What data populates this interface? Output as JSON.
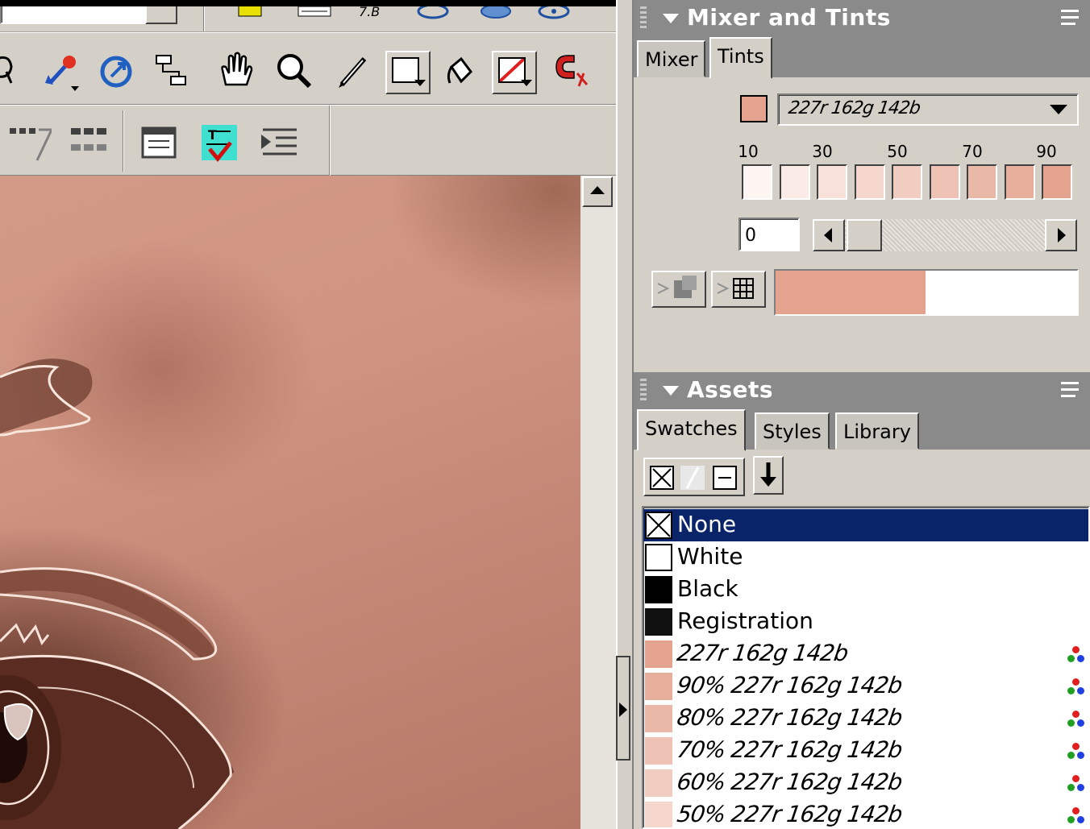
{
  "mixer_panel": {
    "title": "Mixer and Tints",
    "tabs": [
      {
        "label": "Mixer",
        "active": false
      },
      {
        "label": "Tints",
        "active": true
      }
    ],
    "base_color": "#e4a38e",
    "base_color_name": "227r 162g 142b",
    "tint_scale_labels": [
      "10",
      "30",
      "50",
      "70",
      "90"
    ],
    "tint_swatches": [
      "#fdf5f2",
      "#faebe7",
      "#f7e1d9",
      "#f4d6cd",
      "#f1ccc0",
      "#eec2b4",
      "#eab8a7",
      "#e7ae9b",
      "#e4a38e"
    ],
    "tint_value": "0",
    "preview_new": "#e4a38e",
    "preview_old": "#ffffff"
  },
  "assets_panel": {
    "title": "Assets",
    "tabs": [
      {
        "label": "Swatches",
        "active": true
      },
      {
        "label": "Styles",
        "active": false
      },
      {
        "label": "Library",
        "active": false
      }
    ],
    "swatches": [
      {
        "label": "None",
        "color": "none",
        "selected": true,
        "kind": "system"
      },
      {
        "label": "White",
        "color": "#ffffff",
        "selected": false,
        "kind": "system"
      },
      {
        "label": "Black",
        "color": "#000000",
        "selected": false,
        "kind": "system"
      },
      {
        "label": "Registration",
        "color": "#111111",
        "selected": false,
        "kind": "system"
      },
      {
        "label": "227r 162g 142b",
        "color": "#e4a38e",
        "selected": false,
        "kind": "rgb"
      },
      {
        "label": "90% 227r 162g 142b",
        "color": "#e7ae9b",
        "selected": false,
        "kind": "rgb"
      },
      {
        "label": "80% 227r 162g 142b",
        "color": "#eab8a7",
        "selected": false,
        "kind": "rgb"
      },
      {
        "label": "70% 227r 162g 142b",
        "color": "#eec2b4",
        "selected": false,
        "kind": "rgb"
      },
      {
        "label": "60% 227r 162g 142b",
        "color": "#f1ccc0",
        "selected": false,
        "kind": "rgb"
      },
      {
        "label": "50% 227r 162g 142b",
        "color": "#f4d6cd",
        "selected": false,
        "kind": "rgb"
      }
    ]
  },
  "toolbar_icons": {
    "row1": [
      "lasso-tool-icon",
      "eyedropper-tool-icon",
      "link-tool-icon",
      "flow-tool-icon",
      "hand-tool-icon",
      "zoom-tool-icon",
      "pencil-tool-icon",
      "stroke-color-icon",
      "paint-bucket-icon",
      "fill-color-icon",
      "magnet-tool-icon"
    ],
    "row2": [
      "text-tool-icon",
      "table-tool-icon",
      "text-box-icon",
      "spellcheck-icon",
      "indent-icon"
    ]
  },
  "colors": {
    "panel_header": "#8a8a8a",
    "selection": "#0a246a",
    "chrome": "#d4d0c8"
  }
}
